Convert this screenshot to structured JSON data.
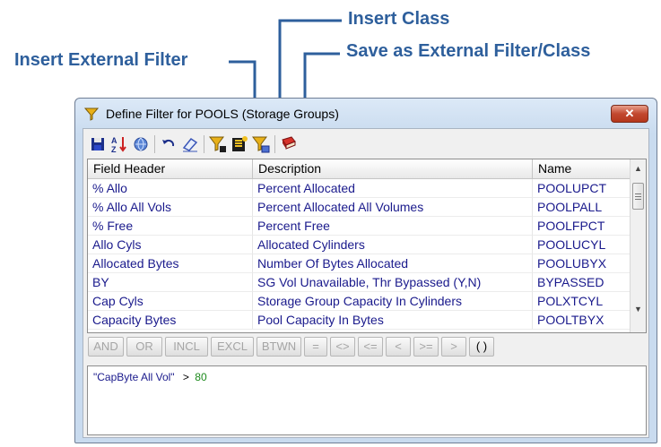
{
  "callouts": {
    "insert_class": "Insert Class",
    "insert_external_filter": "Insert External Filter",
    "save_as_external": "Save as External Filter/Class"
  },
  "window": {
    "title": "Define Filter for POOLS (Storage Groups)",
    "close_label": "✕"
  },
  "toolbar": {
    "icons": [
      "save-icon",
      "sort-icon",
      "globe-icon",
      "undo-icon",
      "eraser-icon",
      "insert-external-filter-icon",
      "insert-class-icon",
      "save-as-external-filter-icon",
      "book-icon"
    ]
  },
  "grid": {
    "headers": [
      "Field Header",
      "Description",
      "Name"
    ],
    "rows": [
      {
        "field": "% Allo",
        "description": "Percent Allocated",
        "name": "POOLUPCT"
      },
      {
        "field": "% Allo All Vols",
        "description": "Percent Allocated All Volumes",
        "name": "POOLPALL"
      },
      {
        "field": "% Free",
        "description": "Percent Free",
        "name": "POOLFPCT"
      },
      {
        "field": "Allo Cyls",
        "description": "Allocated Cylinders",
        "name": "POOLUCYL"
      },
      {
        "field": "Allocated Bytes",
        "description": "Number Of Bytes Allocated",
        "name": "POOLUBYX"
      },
      {
        "field": "BY",
        "description": "SG Vol Unavailable, Thr Bypassed (Y,N)",
        "name": "BYPASSED"
      },
      {
        "field": "Cap Cyls",
        "description": "Storage Group Capacity In Cylinders",
        "name": "POLXTCYL"
      },
      {
        "field": "Capacity Bytes",
        "description": "Pool Capacity In Bytes",
        "name": "POOLTBYX"
      }
    ]
  },
  "operators": [
    "AND",
    "OR",
    "INCL",
    "EXCL",
    "BTWN",
    "=",
    "<>",
    "<=",
    "<",
    ">=",
    ">",
    "( )"
  ],
  "expression": {
    "field": "\"CapByte All Vol\"",
    "operator": ">",
    "value": "80"
  },
  "colors": {
    "callout": "#2e5f9c",
    "grid_text": "#1a1a8c",
    "expression_value": "#1d8a1d"
  }
}
